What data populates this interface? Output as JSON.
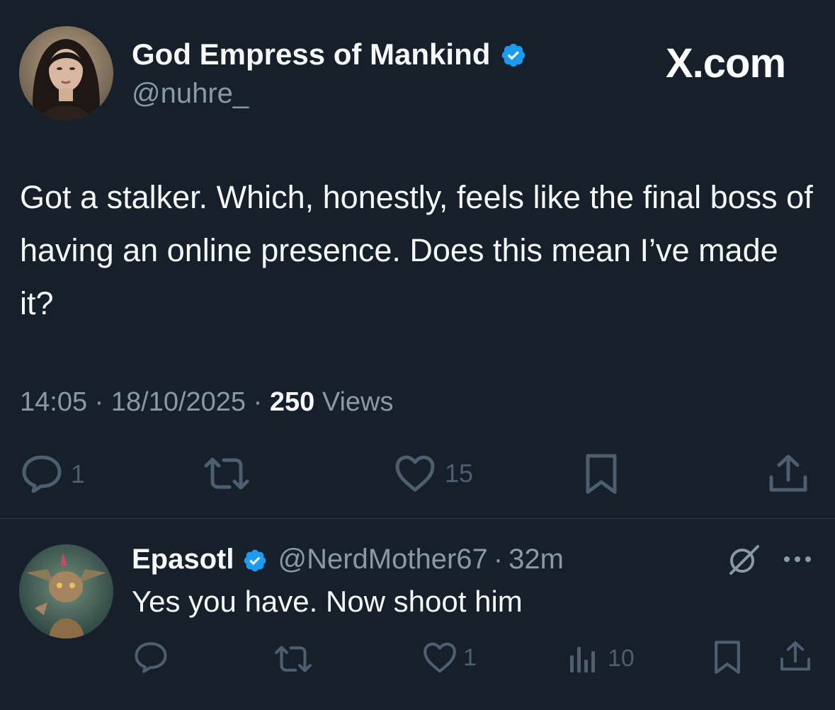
{
  "main_tweet": {
    "author": {
      "name": "God Empress of Mankind",
      "handle": "@nuhre_"
    },
    "brand": "X.com",
    "text": "Got a stalker. Which, honestly, feels like the final boss of having an online presence. Does this mean I’ve made it?",
    "time": "14:05",
    "date": "18/10/2025",
    "separator": "·",
    "views_count": "250",
    "views_label": "Views",
    "actions": {
      "reply_count": "1",
      "like_count": "15"
    }
  },
  "reply": {
    "name": "Epasotl",
    "handle": "@NerdMother67",
    "separator": "·",
    "time": "32m",
    "text": "Yes you have.  Now shoot him",
    "actions": {
      "like_count": "1",
      "views_count": "10"
    }
  },
  "icons": {
    "verified": "verified-badge-icon",
    "reply": "speech-bubble-icon",
    "retweet": "repost-arrows-icon",
    "like": "heart-icon",
    "bookmark": "bookmark-icon",
    "share": "share-upload-icon",
    "views": "bar-chart-icon",
    "grok": "slashed-circle-icon",
    "more": "more-dots-icon"
  },
  "colors": {
    "background": "#15202b",
    "text_primary": "#f7f9f9",
    "text_secondary": "#8b98a5",
    "icon_muted": "#4e5e6e",
    "verified_blue": "#1d9bf0",
    "divider": "#2f3b47"
  }
}
